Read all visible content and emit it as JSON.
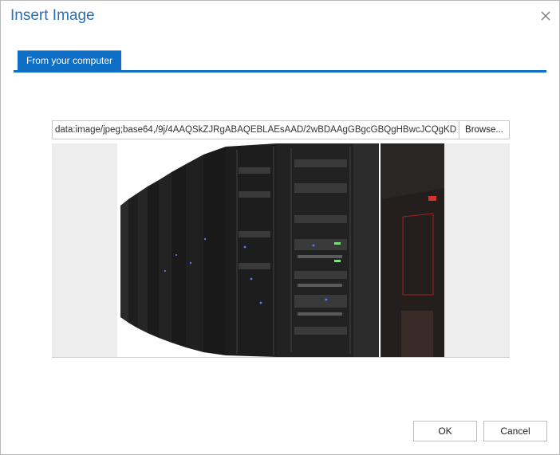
{
  "dialog": {
    "title": "Insert Image",
    "close_icon": "close-icon"
  },
  "tabs": [
    {
      "label": "From your computer",
      "active": true
    }
  ],
  "file": {
    "value": "data:image/jpeg;base64,/9j/4AAQSkZJRgABAQEBLAEsAAD/2wBDAAgGBgcGBQgHBwcJCQgKDB",
    "browse_label": "Browse..."
  },
  "preview": {
    "image": "server-racks-photo"
  },
  "footer": {
    "ok_label": "OK",
    "cancel_label": "Cancel"
  },
  "colors": {
    "accent": "#0f6ec6",
    "title": "#2a6fb7",
    "border": "#c8c8c8"
  }
}
